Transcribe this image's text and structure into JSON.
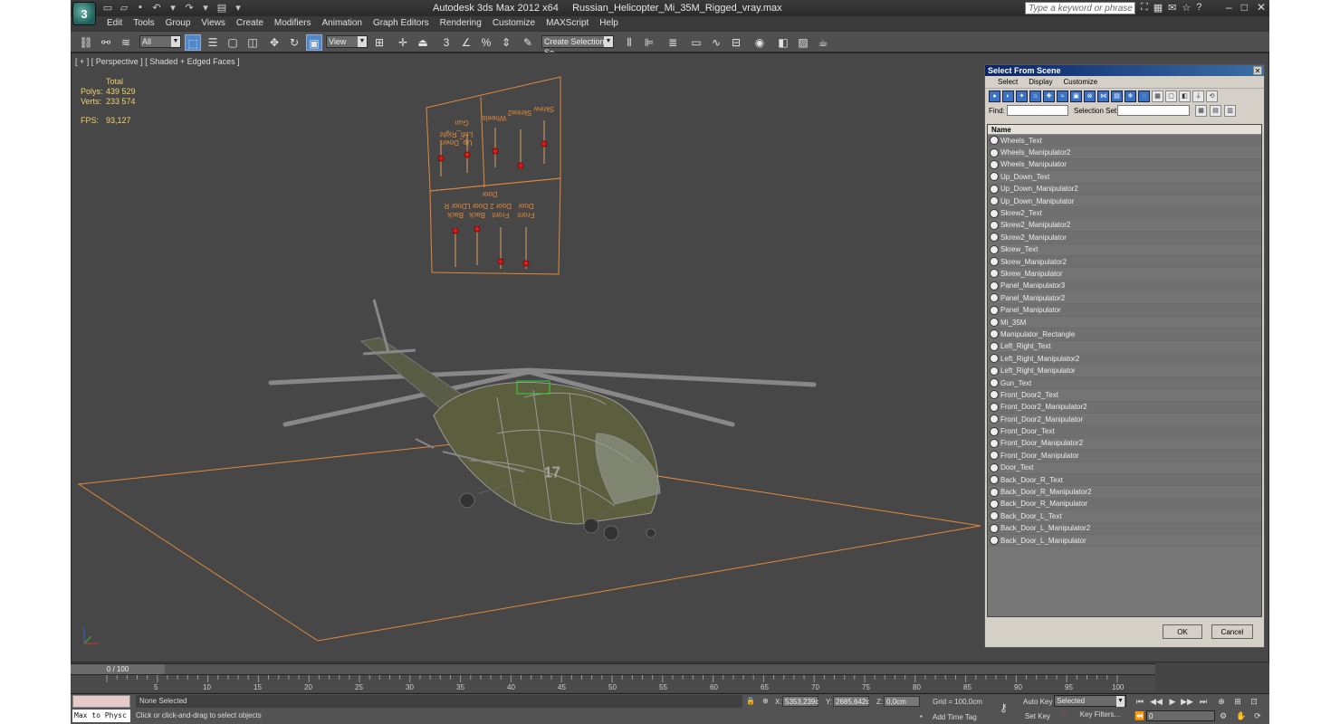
{
  "window": {
    "app_title": "Autodesk 3ds Max  2012 x64",
    "file_name": "Russian_Helicopter_Mi_35M_Rigged_vray.max",
    "search_placeholder": "Type a keyword or phrase",
    "controls": [
      "–",
      "□",
      "✕"
    ]
  },
  "menu": [
    "Edit",
    "Tools",
    "Group",
    "Views",
    "Create",
    "Modifiers",
    "Animation",
    "Graph Editors",
    "Rendering",
    "Customize",
    "MAXScript",
    "Help"
  ],
  "toolbar": {
    "filter_value": "All",
    "refcoord_value": "View",
    "named_selection_value": "Create Selection Se"
  },
  "viewport": {
    "label": "[ + ] [ Perspective ] [ Shaded + Edged Faces ]",
    "stats": {
      "header": "Total",
      "polys_label": "Polys:",
      "polys_value": "439 529",
      "verts_label": "Verts:",
      "verts_value": "233 574",
      "fps_label": "FPS:",
      "fps_value": "93,127"
    },
    "panel_top_labels": [
      "Gun",
      "Up_Down Left_Right",
      "Wheels",
      "Skrew2",
      "Skrew"
    ],
    "panel_bottom_labels": [
      "Door",
      "Back Door R",
      "Back Door L",
      "Front Door 2",
      "Front Door"
    ],
    "heli_number": "17"
  },
  "timeline": {
    "slider_label": "0 / 100",
    "ticks": [
      "5",
      "10",
      "15",
      "20",
      "25",
      "30",
      "35",
      "40",
      "45",
      "50",
      "55",
      "60",
      "65",
      "70",
      "75",
      "80",
      "85",
      "90",
      "95",
      "100"
    ]
  },
  "status": {
    "maxscript_text": "Max to Physc",
    "selection": "None Selected",
    "prompt": "Click or click-and-drag to select objects",
    "x_label": "X:",
    "x_value": "5353,239c",
    "y_label": "Y:",
    "y_value": "2685,642c",
    "z_label": "Z:",
    "z_value": "0,0cm",
    "grid": "Grid = 100,0cm",
    "add_time_tag": "Add Time Tag",
    "auto_key": "Auto Key",
    "selected_value": "Selected",
    "set_key": "Set Key",
    "key_filters": "Key Filters...",
    "frame_value": "0"
  },
  "dialog": {
    "title": "Select From Scene",
    "menu": [
      "Select",
      "Display",
      "Customize"
    ],
    "find_label": "Find:",
    "selection_set_label": "Selection Set:",
    "column_name": "Name",
    "items": [
      "Wheels_Text",
      "Wheels_Manipulator2",
      "Wheels_Manipulator",
      "Up_Down_Text",
      "Up_Down_Manipulator2",
      "Up_Down_Manipulator",
      "Skrew2_Text",
      "Skrew2_Manipulator2",
      "Skrew2_Manipulator",
      "Skrew_Text",
      "Skrew_Manipulator2",
      "Skrew_Manipulator",
      "Panel_Manipulator3",
      "Panel_Manipulator2",
      "Panel_Manipulator",
      "Mi_35M",
      "Manipulator_Rectangle",
      "Left_Right_Text",
      "Left_Right_Manipulator2",
      "Left_Right_Manipulator",
      "Gun_Text",
      "Front_Door2_Text",
      "Front_Door2_Manipulator2",
      "Front_Door2_Manipulator",
      "Front_Door_Text",
      "Front_Door_Manipulator2",
      "Front_Door_Manipulator",
      "Door_Text",
      "Back_Door_R_Text",
      "Back_Door_R_Manipulator2",
      "Back_Door_R_Manipulator",
      "Back_Door_L_Text",
      "Back_Door_L_Manipulator2",
      "Back_Door_L_Manipulator"
    ],
    "ok_label": "OK",
    "cancel_label": "Cancel"
  },
  "colors": {
    "accent_orange": "#e08a3c",
    "stats_yellow": "#f2d36b",
    "dialog_title": "#0a246a"
  }
}
